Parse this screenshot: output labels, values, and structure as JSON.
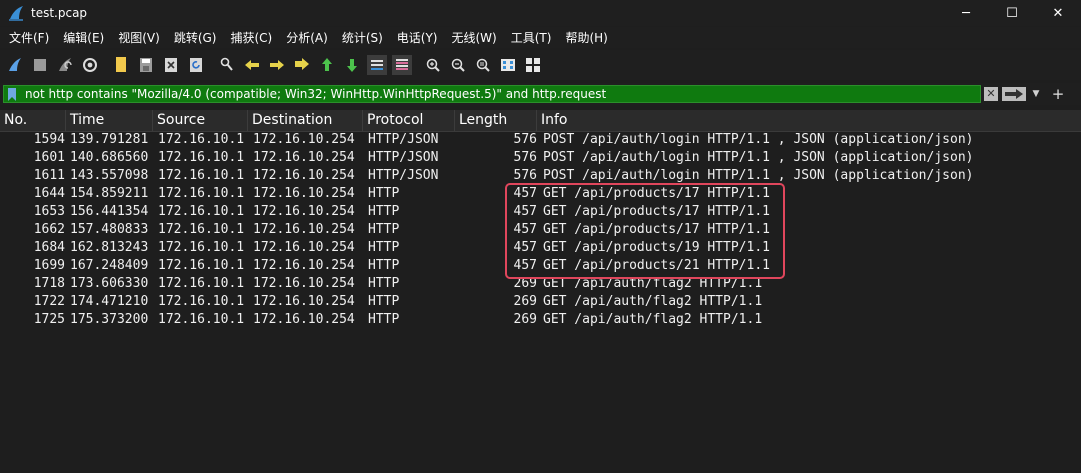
{
  "window": {
    "title": "test.pcap",
    "minimize_glyph": "─",
    "maximize_glyph": "☐",
    "close_glyph": "✕",
    "icon": "wireshark-fin-icon"
  },
  "menu": [
    "文件(F)",
    "编辑(E)",
    "视图(V)",
    "跳转(G)",
    "捕获(C)",
    "分析(A)",
    "统计(S)",
    "电话(Y)",
    "无线(W)",
    "工具(T)",
    "帮助(H)"
  ],
  "toolbar_icons": [
    "start-capture-icon",
    "stop-capture-icon",
    "restart-capture-icon",
    "capture-options-icon",
    "open-file-icon",
    "save-file-icon",
    "close-file-icon",
    "reload-file-icon",
    "find-packet-icon",
    "go-back-icon",
    "go-forward-icon",
    "go-to-packet-icon",
    "go-first-icon",
    "go-last-icon",
    "auto-scroll-icon",
    "colorize-icon",
    "zoom-in-icon",
    "zoom-out-icon",
    "zoom-normal-icon",
    "resize-columns-icon"
  ],
  "filter": {
    "text": "not http contains \"Mozilla/4.0 (compatible; Win32; WinHttp.WinHttpRequest.5)\" and http.request",
    "clear_glyph": "✕",
    "dropdown_glyph": "▼",
    "add_glyph": "+",
    "background_color": "#0f7a0f"
  },
  "columns": [
    "No.",
    "Time",
    "Source",
    "Destination",
    "Protocol",
    "Length",
    "Info"
  ],
  "packets": [
    {
      "no": "1594",
      "time": "139.791281",
      "src": "172.16.10.1",
      "dst": "172.16.10.254",
      "proto": "HTTP/JSON",
      "len": "576",
      "info": "POST /api/auth/login HTTP/1.1 , JSON (application/json)"
    },
    {
      "no": "1601",
      "time": "140.686560",
      "src": "172.16.10.1",
      "dst": "172.16.10.254",
      "proto": "HTTP/JSON",
      "len": "576",
      "info": "POST /api/auth/login HTTP/1.1 , JSON (application/json)"
    },
    {
      "no": "1611",
      "time": "143.557098",
      "src": "172.16.10.1",
      "dst": "172.16.10.254",
      "proto": "HTTP/JSON",
      "len": "576",
      "info": "POST /api/auth/login HTTP/1.1 , JSON (application/json)"
    },
    {
      "no": "1644",
      "time": "154.859211",
      "src": "172.16.10.1",
      "dst": "172.16.10.254",
      "proto": "HTTP",
      "len": "457",
      "info": "GET /api/products/17 HTTP/1.1"
    },
    {
      "no": "1653",
      "time": "156.441354",
      "src": "172.16.10.1",
      "dst": "172.16.10.254",
      "proto": "HTTP",
      "len": "457",
      "info": "GET /api/products/17 HTTP/1.1"
    },
    {
      "no": "1662",
      "time": "157.480833",
      "src": "172.16.10.1",
      "dst": "172.16.10.254",
      "proto": "HTTP",
      "len": "457",
      "info": "GET /api/products/17 HTTP/1.1"
    },
    {
      "no": "1684",
      "time": "162.813243",
      "src": "172.16.10.1",
      "dst": "172.16.10.254",
      "proto": "HTTP",
      "len": "457",
      "info": "GET /api/products/19 HTTP/1.1"
    },
    {
      "no": "1699",
      "time": "167.248409",
      "src": "172.16.10.1",
      "dst": "172.16.10.254",
      "proto": "HTTP",
      "len": "457",
      "info": "GET /api/products/21 HTTP/1.1"
    },
    {
      "no": "1718",
      "time": "173.606330",
      "src": "172.16.10.1",
      "dst": "172.16.10.254",
      "proto": "HTTP",
      "len": "269",
      "info": "GET /api/auth/flag2 HTTP/1.1"
    },
    {
      "no": "1722",
      "time": "174.471210",
      "src": "172.16.10.1",
      "dst": "172.16.10.254",
      "proto": "HTTP",
      "len": "269",
      "info": "GET /api/auth/flag2 HTTP/1.1"
    },
    {
      "no": "1725",
      "time": "175.373200",
      "src": "172.16.10.1",
      "dst": "172.16.10.254",
      "proto": "HTTP",
      "len": "269",
      "info": "GET /api/auth/flag2 HTTP/1.1"
    }
  ],
  "annotation": {
    "color": "#e0465c"
  }
}
